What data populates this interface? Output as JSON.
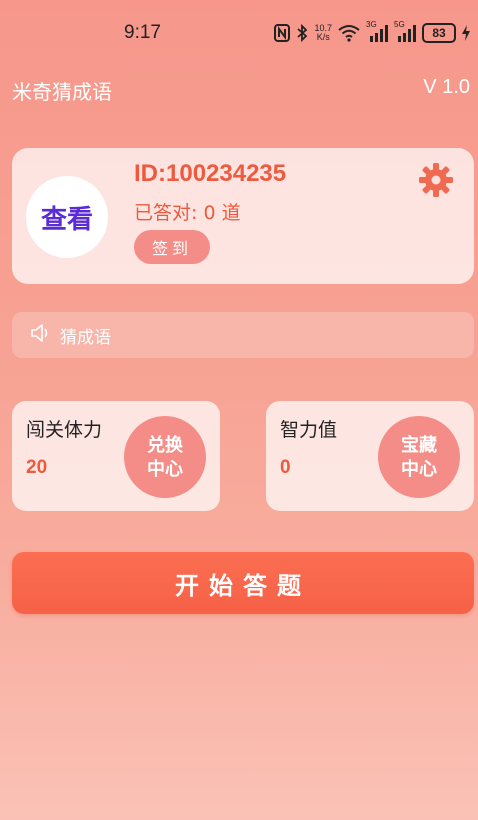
{
  "status_bar": {
    "time": "9:17",
    "speed_value": "10.7",
    "speed_unit": "K/s",
    "net_1": "3G",
    "net_2": "5G",
    "battery": "83"
  },
  "header": {
    "title": "米奇猜成语",
    "version": "V 1.0"
  },
  "profile": {
    "avatar_text": "查看",
    "user_id": "ID:100234235",
    "answered": "已答对: 0 道",
    "signin_label": "签到"
  },
  "notice": {
    "text": "猜成语"
  },
  "stats": {
    "stamina": {
      "label": "闯关体力",
      "value": "20",
      "button": "兑换中心"
    },
    "iq": {
      "label": "智力值",
      "value": "0",
      "button": "宝藏中心"
    }
  },
  "start_label": "开始答题",
  "colors": {
    "accent": "#ee5a3e",
    "button": "#f66147",
    "circle": "#f48d87",
    "avatar_text": "#5a2bd6"
  },
  "icons": {
    "settings": "gear-icon",
    "notice": "speaker-icon"
  }
}
